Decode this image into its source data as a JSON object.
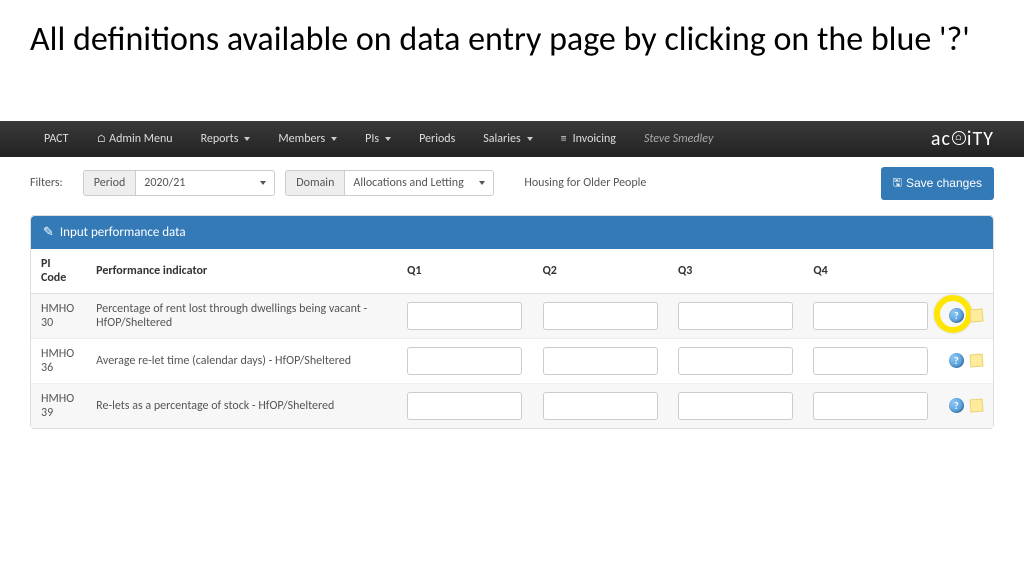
{
  "slide": {
    "title": "All definitions available on data entry page by clicking on the blue '?'"
  },
  "nav": {
    "brand": "PACT",
    "items": [
      "Admin Menu",
      "Reports",
      "Members",
      "PIs",
      "Periods",
      "Salaries",
      "Invoicing"
    ],
    "user": "Steve Smedley",
    "logo_text": "acuity"
  },
  "filters": {
    "label": "Filters:",
    "period_label": "Period",
    "period_value": "2020/21",
    "domain_label": "Domain",
    "domain_value": "Allocations and Letting",
    "context": "Housing for Older People",
    "save_button": "Save changes"
  },
  "panel": {
    "heading": "Input performance data",
    "columns": {
      "code": "PI Code",
      "indicator": "Performance indicator",
      "q1": "Q1",
      "q2": "Q2",
      "q3": "Q3",
      "q4": "Q4"
    },
    "rows": [
      {
        "code": "HMHO 30",
        "indicator": "Percentage of rent lost through dwellings being vacant - HfOP/Sheltered"
      },
      {
        "code": "HMHO 36",
        "indicator": "Average re-let time (calendar days) - HfOP/Sheltered"
      },
      {
        "code": "HMHO 39",
        "indicator": "Re-lets as a percentage of stock - HfOP/Sheltered"
      }
    ]
  }
}
